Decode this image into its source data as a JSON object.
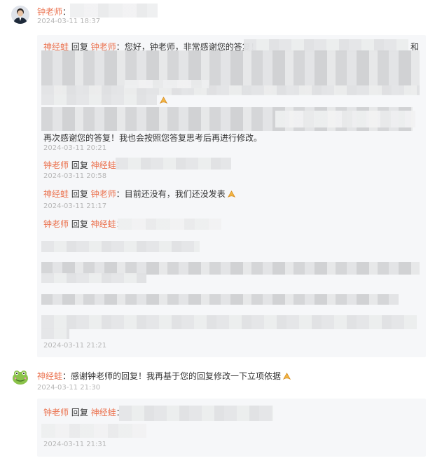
{
  "post1": {
    "author": "钟老师",
    "colon": "：",
    "timestamp": "2024-03-11 18:37",
    "replies": [
      {
        "from": "神经蛙",
        "verb": " 回复 ",
        "to": "钟老师",
        "colon": "：",
        "text": "您好，钟老师，非常感谢您的答复！",
        "tail_char": "和",
        "tail_text": "再次感谢您的答复！我也会按照您答复思考后再进行修改。",
        "timestamp": "2024-03-11 20:21"
      },
      {
        "from": "钟老师",
        "verb": " 回复 ",
        "to": "神经蛙",
        "colon": "：",
        "text": "",
        "timestamp": "2024-03-11 20:58"
      },
      {
        "from": "神经蛙",
        "verb": " 回复 ",
        "to": "钟老师",
        "colon": "：",
        "text": "目前还没有，我们还没发表",
        "timestamp": "2024-03-11 21:17"
      },
      {
        "from": "钟老师",
        "verb": " 回复 ",
        "to": "神经蛙",
        "colon": "：",
        "text": "",
        "timestamp": "2024-03-11 21:21"
      }
    ]
  },
  "post2": {
    "author": "神经蛙",
    "colon": "：",
    "text": "感谢钟老师的回复！我再基于您的回复修改一下立项依据",
    "timestamp": "2024-03-11 21:30",
    "replies": [
      {
        "from": "钟老师",
        "verb": " 回复 ",
        "to": "神经蛙",
        "colon": "：",
        "text": "",
        "timestamp": "2024-03-11 21:31"
      }
    ]
  },
  "icons": {
    "avatar1": "teacher-avatar-icon",
    "avatar2": "frog-avatar-icon",
    "emoji": "pray-hands-emoji-icon"
  },
  "colors": {
    "username": "#eb7350",
    "timestamp": "#b7b7b7",
    "reply_bg": "#f6f7f9"
  }
}
